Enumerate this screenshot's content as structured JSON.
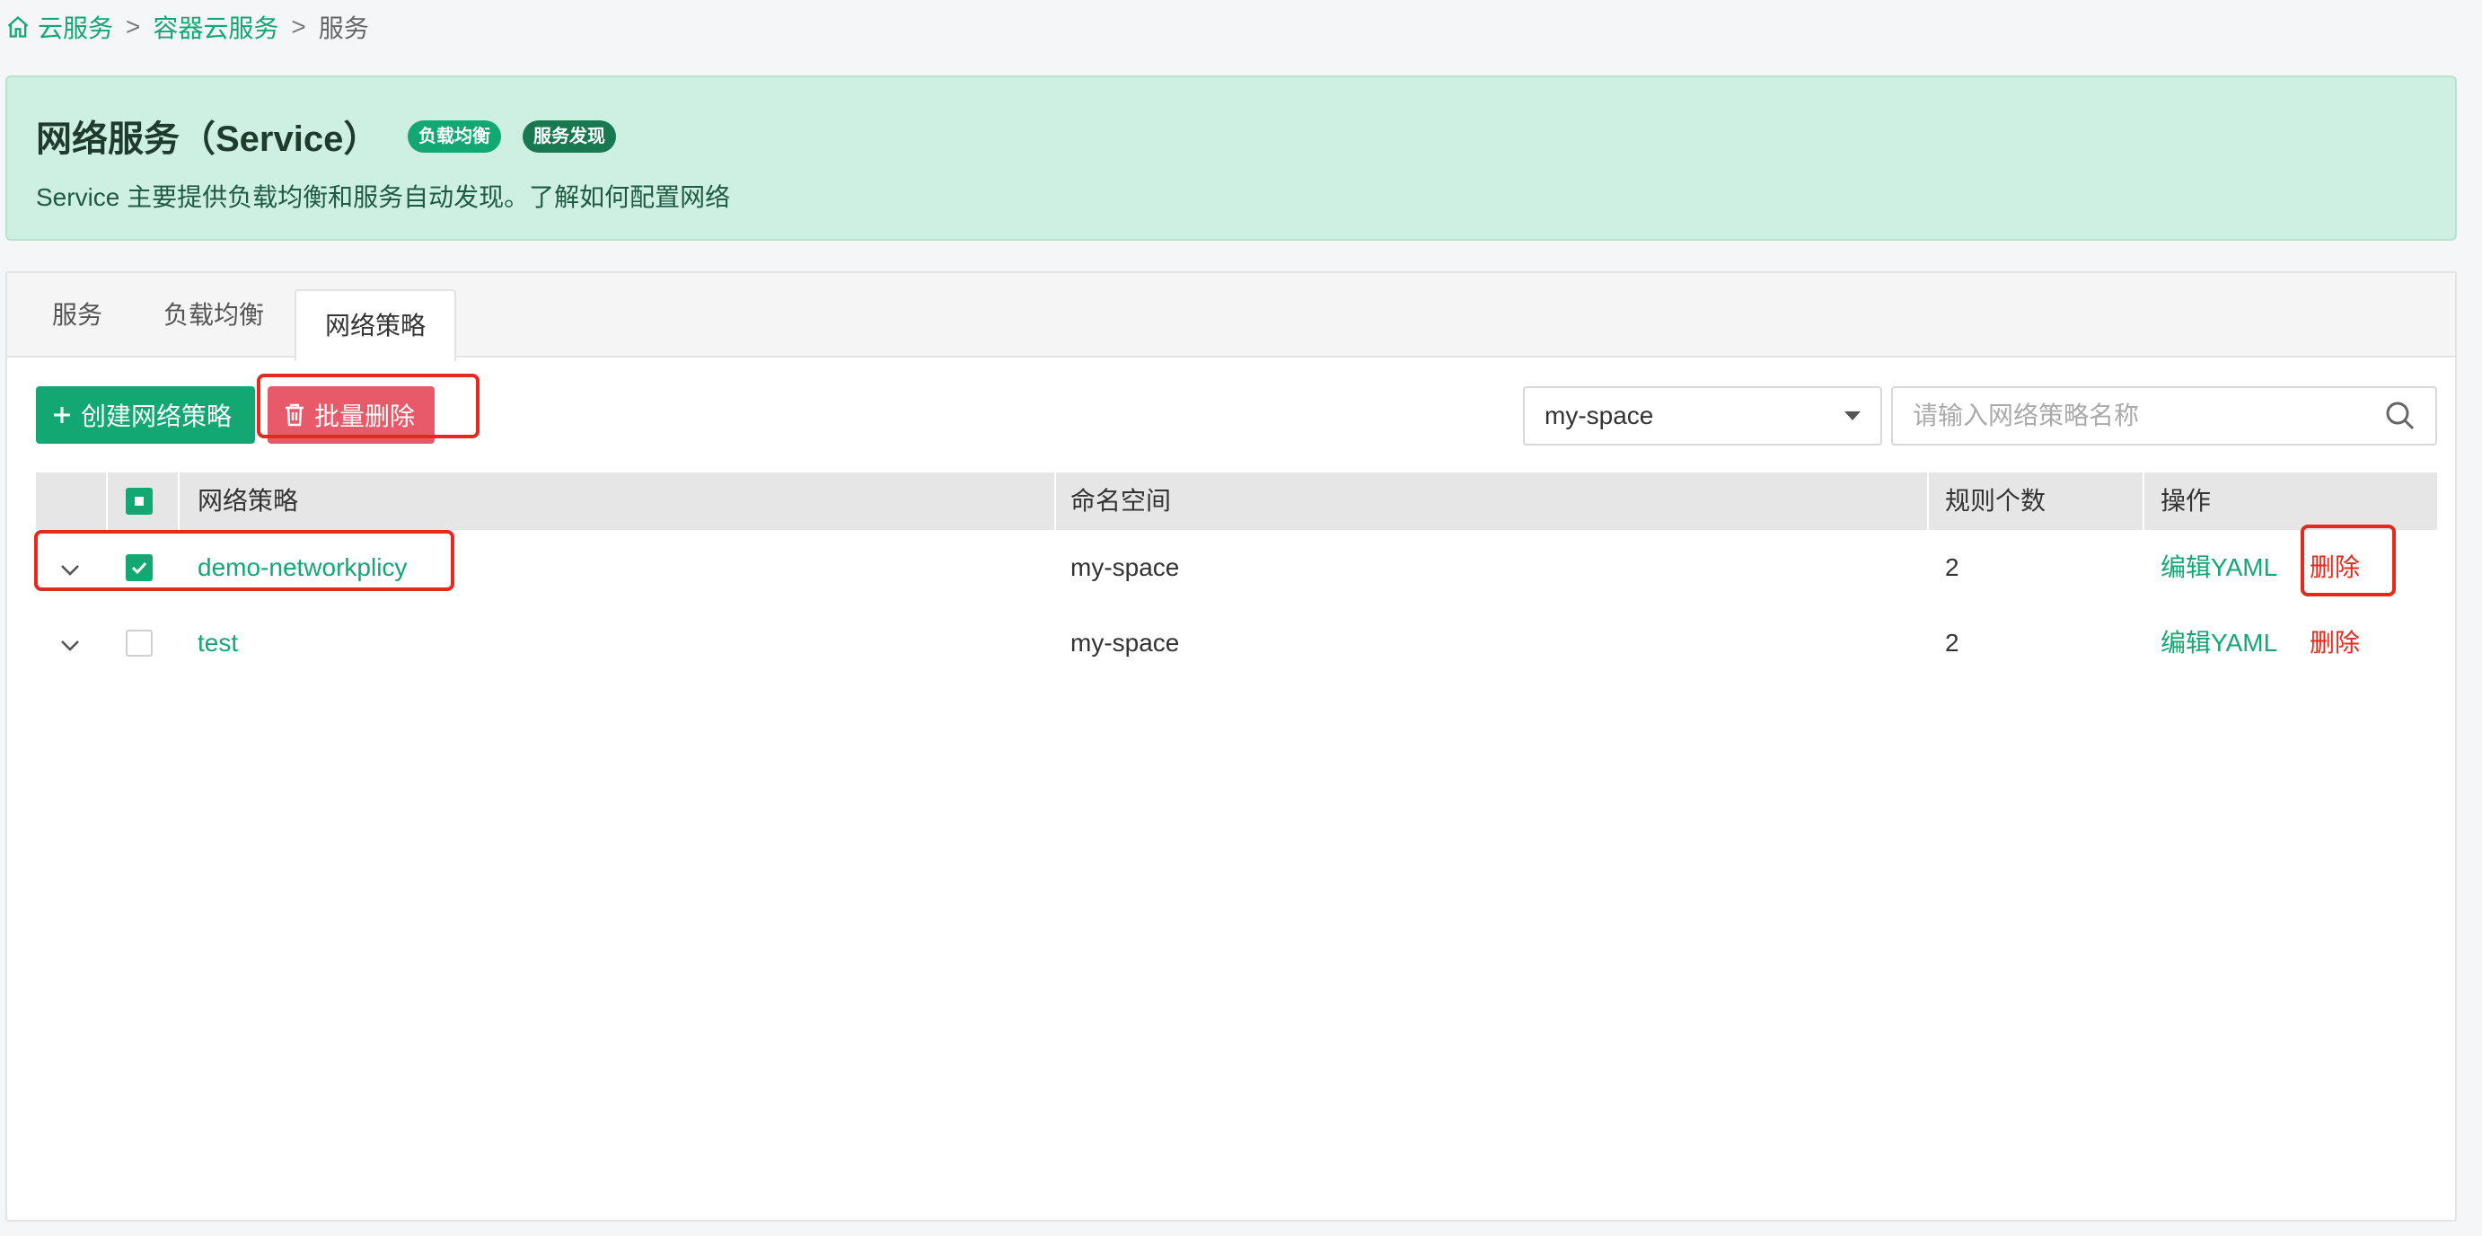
{
  "breadcrumb": {
    "items": [
      "云服务",
      "容器云服务"
    ],
    "separator": ">",
    "current": "服务"
  },
  "banner": {
    "title": "网络服务（Service）",
    "badges": [
      "负载均衡",
      "服务发现"
    ],
    "description": "Service 主要提供负载均衡和服务自动发现。了解如何配置网络"
  },
  "tabs": [
    {
      "label": "服务",
      "active": false
    },
    {
      "label": "负载均衡",
      "active": false
    },
    {
      "label": "网络策略",
      "active": true
    }
  ],
  "toolbar": {
    "create_label": "创建网络策略",
    "batch_delete_label": "批量删除",
    "namespace_selected": "my-space",
    "search_placeholder": "请输入网络策略名称"
  },
  "table": {
    "headers": [
      "网络策略",
      "命名空间",
      "规则个数",
      "操作"
    ],
    "rows": [
      {
        "name": "demo-networkplicy",
        "namespace": "my-space",
        "rules": "2",
        "edit": "编辑YAML",
        "delete": "删除",
        "checked": true
      },
      {
        "name": "test",
        "namespace": "my-space",
        "rules": "2",
        "edit": "编辑YAML",
        "delete": "删除",
        "checked": false
      }
    ]
  },
  "colors": {
    "primary": "#13a873",
    "danger": "#e8281c",
    "banner_bg": "#cdf0e2"
  }
}
